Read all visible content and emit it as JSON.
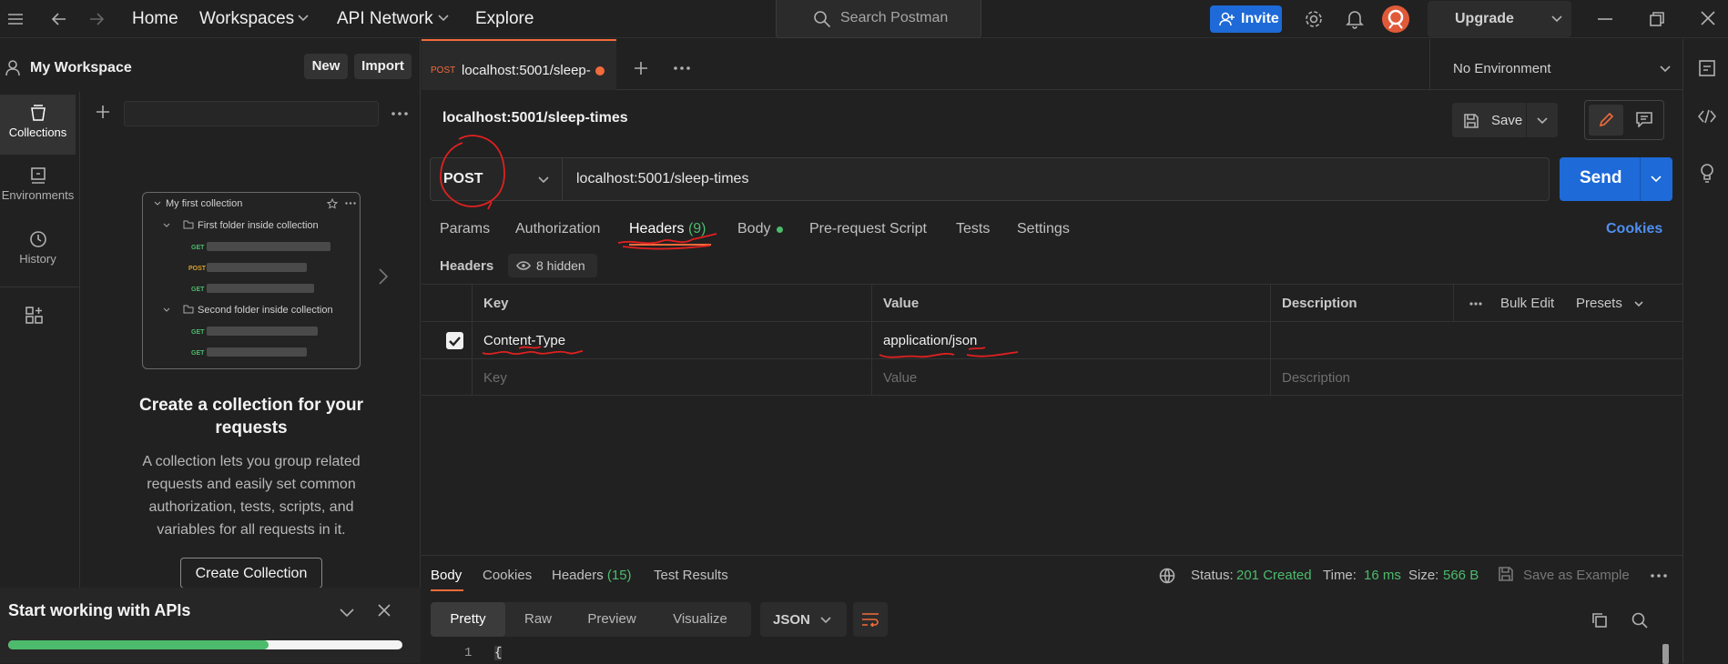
{
  "topbar": {
    "nav": [
      "Home",
      "Workspaces",
      "API Network",
      "Explore"
    ],
    "search_placeholder": "Search Postman",
    "invite": "Invite",
    "upgrade": "Upgrade"
  },
  "sidebar": {
    "workspace": "My Workspace",
    "new": "New",
    "import": "Import",
    "rail": [
      {
        "label": "Collections",
        "icon": "collections-icon"
      },
      {
        "label": "Environments",
        "icon": "environments-icon"
      },
      {
        "label": "History",
        "icon": "history-icon"
      }
    ],
    "illustration": {
      "collection": "My first collection",
      "folder1": "First folder inside collection",
      "folder2": "Second folder inside collection",
      "methods": [
        "GET",
        "POST",
        "GET",
        "GET",
        "GET"
      ]
    },
    "empty_title": "Create a collection for your requests",
    "empty_desc": "A collection lets you group related requests and easily set common authorization, tests, scripts, and variables for all requests in it.",
    "create_button": "Create Collection",
    "start_banner": "Start working with APIs",
    "start_progress": 0.66
  },
  "tabs": {
    "active": {
      "method": "POST",
      "label": "localhost:5001/sleep-"
    },
    "environment": "No Environment"
  },
  "request": {
    "name": "localhost:5001/sleep-times",
    "save": "Save",
    "method": "POST",
    "url": "localhost:5001/sleep-times",
    "send": "Send",
    "tabs": [
      "Params",
      "Authorization",
      "Headers",
      "Body",
      "Pre-request Script",
      "Tests",
      "Settings"
    ],
    "headers_count": "(9)",
    "cookies": "Cookies",
    "headers_label": "Headers",
    "hidden": "8 hidden",
    "columns": [
      "Key",
      "Value",
      "Description"
    ],
    "bulk_edit": "Bulk Edit",
    "presets": "Presets",
    "rows": [
      {
        "key": "Content-Type",
        "value": "application/json",
        "description": "",
        "checked": true
      }
    ],
    "placeholders": {
      "key": "Key",
      "value": "Value",
      "description": "Description"
    }
  },
  "response": {
    "tabs": [
      "Body",
      "Cookies",
      "Headers",
      "Test Results"
    ],
    "headers_count": "(15)",
    "status_label": "Status:",
    "status": "201 Created",
    "time_label": "Time:",
    "time": "16 ms",
    "size_label": "Size:",
    "size": "566 B",
    "save_example": "Save as Example",
    "formats": [
      "Pretty",
      "Raw",
      "Preview",
      "Visualize"
    ],
    "language": "JSON",
    "line_number": "1",
    "line_content": "{"
  },
  "colors": {
    "accent": "#f26b3a",
    "primary": "#1d6ad8",
    "success": "#4cbb6c",
    "annotation": "#e02020"
  }
}
